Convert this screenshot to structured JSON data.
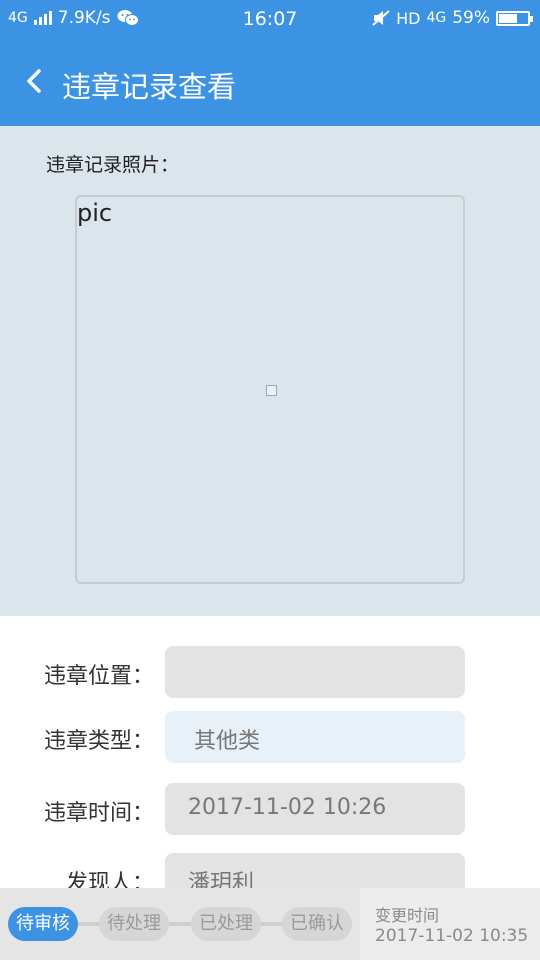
{
  "status_bar": {
    "network": "4G",
    "speed": "7.9K/s",
    "time": "16:07",
    "hd": "HD",
    "network2": "4G",
    "battery": "59%",
    "battery_level": 0.59
  },
  "app_bar": {
    "title": "违章记录查看"
  },
  "photo": {
    "label": "违章记录照片：",
    "alt_text": "pic"
  },
  "form": {
    "location_label": "违章位置：",
    "location_value": "",
    "type_label": "违章类型：",
    "type_value": "其他类",
    "time_label": "违章时间：",
    "time_value": "2017-11-02 10:26",
    "finder_label": "发现人：",
    "finder_value": "潘玥利"
  },
  "bottom": {
    "steps": [
      "待审核",
      "待处理",
      "已处理",
      "已确认"
    ],
    "active_step": 0,
    "change_label": "变更时间",
    "change_value": "2017-11-02 10:35"
  },
  "colors": {
    "primary": "#3c93e4",
    "photo_bg": "#dbe5ec"
  }
}
